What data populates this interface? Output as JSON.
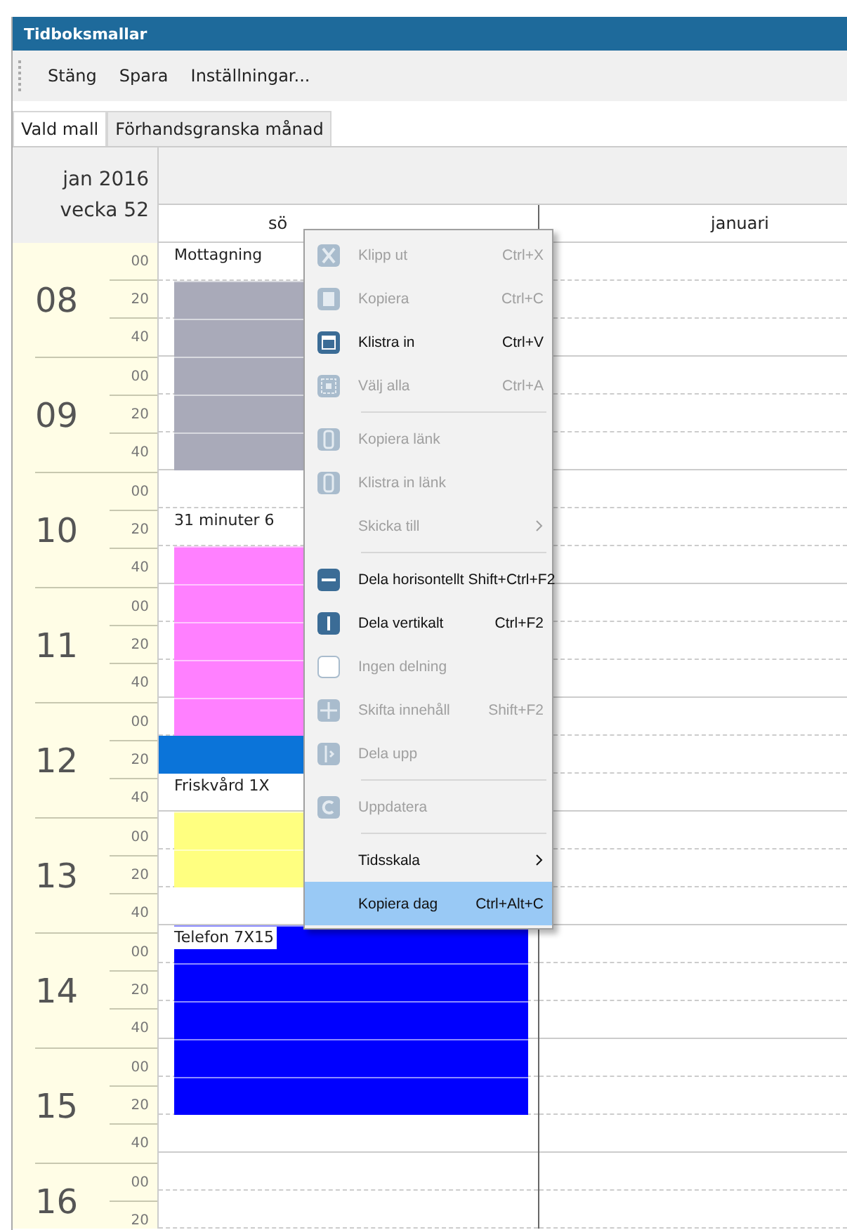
{
  "window": {
    "title": "Tidboksmallar"
  },
  "toolbar": [
    "Stäng",
    "Spara",
    "Inställningar..."
  ],
  "tabs": [
    {
      "label": "Vald mall",
      "selected": true
    },
    {
      "label": "Förhandsgranska månad",
      "selected": false
    }
  ],
  "header": {
    "month": "jan 2016",
    "week": "vecka 52"
  },
  "hours": [
    {
      "hour": "08",
      "minutes": [
        "00",
        "20",
        "40"
      ]
    },
    {
      "hour": "09",
      "minutes": [
        "00",
        "20",
        "40"
      ]
    },
    {
      "hour": "10",
      "minutes": [
        "00",
        "20",
        "40"
      ]
    },
    {
      "hour": "11",
      "minutes": [
        "00",
        "20",
        "40"
      ]
    },
    {
      "hour": "12",
      "minutes": [
        "00",
        "20",
        "40"
      ]
    },
    {
      "hour": "13",
      "minutes": [
        "00",
        "20",
        "40"
      ]
    },
    {
      "hour": "14",
      "minutes": [
        "00",
        "20",
        "40"
      ]
    },
    {
      "hour": "15",
      "minutes": [
        "00",
        "20",
        "40"
      ]
    },
    {
      "hour": "16",
      "minutes": [
        "00",
        "20"
      ]
    }
  ],
  "days": [
    {
      "header": "sö",
      "slots": [
        {
          "kind": "label",
          "text": "Mottagning"
        },
        {
          "kind": "block",
          "color": "#a9aab9"
        },
        {
          "kind": "block",
          "color": "#a9aab9"
        },
        {
          "kind": "block",
          "color": "#a9aab9"
        },
        {
          "kind": "block",
          "color": "#a9aab9"
        },
        {
          "kind": "block",
          "color": "#a9aab9"
        },
        {
          "kind": "empty"
        },
        {
          "kind": "label",
          "text": "31 minuter 6"
        },
        {
          "kind": "block",
          "color": "#ff80ff"
        },
        {
          "kind": "block",
          "color": "#ff80ff"
        },
        {
          "kind": "block",
          "color": "#ff80ff"
        },
        {
          "kind": "block",
          "color": "#ff80ff"
        },
        {
          "kind": "block",
          "color": "#ff80ff"
        },
        {
          "kind": "bar",
          "color": "#0b74d9"
        },
        {
          "kind": "label",
          "text": "Friskvård 1X"
        },
        {
          "kind": "block",
          "color": "#ffff80"
        },
        {
          "kind": "block",
          "color": "#ffff80"
        },
        {
          "kind": "empty"
        },
        {
          "kind": "block",
          "color": "#0000ff",
          "text": "Telefon 7X15"
        },
        {
          "kind": "block",
          "color": "#0000ff"
        },
        {
          "kind": "block",
          "color": "#0000ff"
        },
        {
          "kind": "block",
          "color": "#0000ff"
        },
        {
          "kind": "block",
          "color": "#0000ff"
        },
        {
          "kind": "empty"
        },
        {
          "kind": "empty"
        },
        {
          "kind": "empty"
        }
      ]
    },
    {
      "header": "januari"
    }
  ],
  "context_menu": {
    "items": [
      {
        "kind": "item",
        "label": "Klipp ut",
        "shortcut": "Ctrl+X",
        "disabled": true,
        "selected": false
      },
      {
        "kind": "item",
        "label": "Kopiera",
        "shortcut": "Ctrl+C",
        "disabled": true,
        "selected": false
      },
      {
        "kind": "item",
        "label": "Klistra in",
        "shortcut": "Ctrl+V",
        "disabled": false,
        "selected": false
      },
      {
        "kind": "item",
        "label": "Välj alla",
        "shortcut": "Ctrl+A",
        "disabled": true,
        "selected": false
      },
      {
        "kind": "separator"
      },
      {
        "kind": "item",
        "label": "Kopiera länk",
        "disabled": true,
        "selected": false
      },
      {
        "kind": "item",
        "label": "Klistra in länk",
        "disabled": true,
        "selected": false
      },
      {
        "kind": "item",
        "label": "Skicka till",
        "submenu": true,
        "disabled": true,
        "selected": false
      },
      {
        "kind": "separator"
      },
      {
        "kind": "item",
        "label": "Dela horisontellt",
        "shortcut": "Shift+Ctrl+F2",
        "disabled": false,
        "selected": false
      },
      {
        "kind": "item",
        "label": "Dela vertikalt",
        "shortcut": "Ctrl+F2",
        "disabled": false,
        "selected": false
      },
      {
        "kind": "item",
        "label": "Ingen delning",
        "disabled": true,
        "selected": false
      },
      {
        "kind": "item",
        "label": "Skifta innehåll",
        "shortcut": "Shift+F2",
        "disabled": true,
        "selected": false
      },
      {
        "kind": "item",
        "label": "Dela upp",
        "disabled": true,
        "selected": false
      },
      {
        "kind": "separator"
      },
      {
        "kind": "item",
        "label": "Uppdatera",
        "disabled": true,
        "selected": false
      },
      {
        "kind": "separator"
      },
      {
        "kind": "item",
        "label": "Tidsskala",
        "submenu": true,
        "disabled": false,
        "selected": false
      },
      {
        "kind": "item",
        "label": "Kopiera dag",
        "shortcut": "Ctrl+Alt+C",
        "disabled": false,
        "selected": true
      }
    ]
  }
}
